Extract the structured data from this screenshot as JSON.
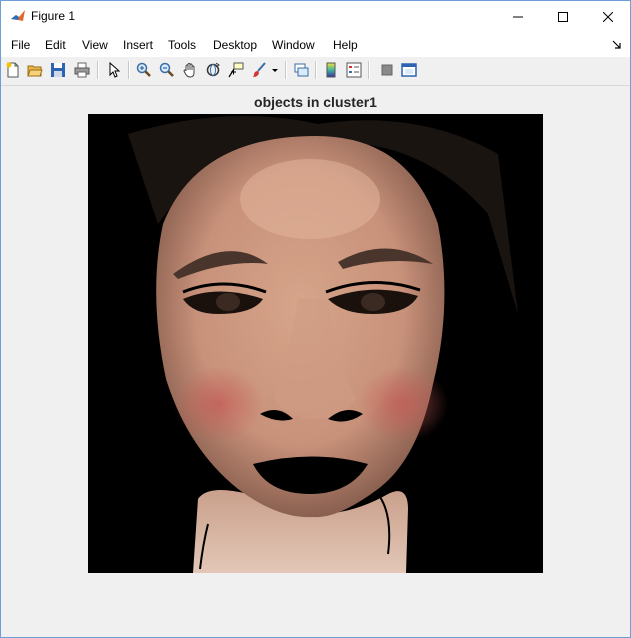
{
  "window": {
    "title": "Figure 1"
  },
  "menu": {
    "items": [
      "File",
      "Edit",
      "View",
      "Insert",
      "Tools",
      "Desktop",
      "Window",
      "Help"
    ]
  },
  "toolbar": {
    "icons": [
      "new-figure-icon",
      "open-file-icon",
      "save-icon",
      "print-icon",
      "pointer-icon",
      "zoom-in-icon",
      "zoom-out-icon",
      "pan-icon",
      "rotate-3d-icon",
      "data-cursor-icon",
      "brush-icon",
      "link-plot-icon",
      "colorbar-icon",
      "legend-icon",
      "hide-plot-tools-icon",
      "show-plot-tools-icon"
    ]
  },
  "plot": {
    "title": "objects in cluster1"
  }
}
